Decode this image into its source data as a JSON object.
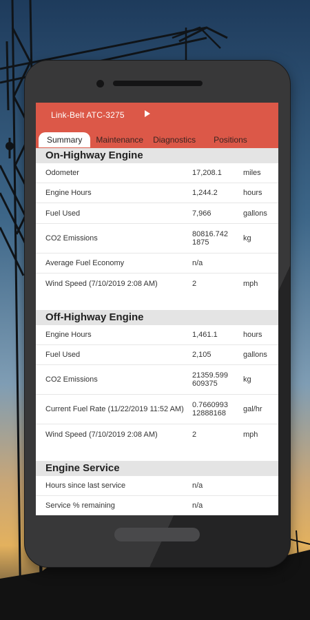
{
  "app": {
    "title": "Link-Belt ATC-3275"
  },
  "tabs": [
    {
      "label": "Summary",
      "active": true
    },
    {
      "label": "Maintenance",
      "active": false
    },
    {
      "label": "Diagnostics",
      "active": false
    },
    {
      "label": "Positions",
      "active": false
    }
  ],
  "sections": [
    {
      "title": "On-Highway Engine",
      "rows": [
        {
          "label": "Odometer",
          "value": "17,208.1",
          "unit": "miles"
        },
        {
          "label": "Engine Hours",
          "value": "1,244.2",
          "unit": "hours"
        },
        {
          "label": "Fuel Used",
          "value": "7,966",
          "unit": "gallons"
        },
        {
          "label": "CO2 Emissions",
          "value": "80816.742 1875",
          "unit": "kg"
        },
        {
          "label": "Average Fuel Economy",
          "value": "n/a",
          "unit": ""
        },
        {
          "label": "Wind Speed (7/10/2019 2:08 AM)",
          "value": "2",
          "unit": "mph"
        }
      ]
    },
    {
      "title": "Off-Highway Engine",
      "rows": [
        {
          "label": "Engine Hours",
          "value": "1,461.1",
          "unit": "hours"
        },
        {
          "label": "Fuel Used",
          "value": "2,105",
          "unit": "gallons"
        },
        {
          "label": "CO2 Emissions",
          "value": "21359.599 609375",
          "unit": "kg"
        },
        {
          "label": "Current Fuel Rate (11/22/2019 11:52 AM)",
          "value": "0.7660993 12888168",
          "unit": "gal/hr"
        },
        {
          "label": "Wind Speed (7/10/2019 2:08 AM)",
          "value": "2",
          "unit": "mph"
        }
      ]
    },
    {
      "title": "Engine Service",
      "rows": [
        {
          "label": "Hours since last service",
          "value": "n/a",
          "unit": ""
        },
        {
          "label": "Service % remaining",
          "value": "n/a",
          "unit": ""
        }
      ]
    }
  ],
  "colors": {
    "header": "#dc5848",
    "section_bg": "#e4e4e4",
    "phone_body": "#2c2c2d"
  }
}
